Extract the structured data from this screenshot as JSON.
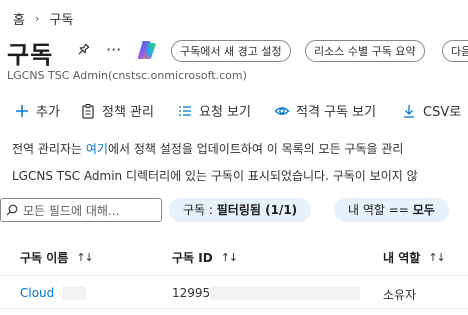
{
  "breadcrumb": {
    "home": "홈",
    "current": "구독"
  },
  "header": {
    "title": "구독",
    "subtitle": "LGCNS TSC Admin(cnstsc.onmicrosoft.com)",
    "chips": [
      "구독에서 새 경고 설정",
      "리소스 수별 구독 요약",
      "다음"
    ]
  },
  "toolbar": {
    "add": "추가",
    "policy": "정책 관리",
    "request": "요청 보기",
    "eligible": "적격 구독 보기",
    "csv": "CSV로"
  },
  "info": {
    "line1_pre": "전역 관리자는 ",
    "line1_link": "여기",
    "line1_post": "에서 정책 설정을 업데이트하여 이 목록의 모든 구독을 관리",
    "line2": "LGCNS TSC Admin 디렉터리에 있는 구독이 표시되었습니다. 구독이 보이지 않"
  },
  "filters": {
    "search_placeholder": "모든 필드에 대해...",
    "subscription_label": "구독 : ",
    "subscription_value": "필터링됨 (1/1)",
    "role_label": "내 역할 == ",
    "role_value": "모두"
  },
  "table": {
    "headers": [
      "구독 이름",
      "구독 ID",
      "내 역할"
    ],
    "sort_glyph": "↑↓",
    "rows": [
      {
        "name": "Cloud",
        "id": "12995",
        "role": "소유자"
      }
    ]
  },
  "colors": {
    "accent": "#0078d4",
    "filter_bg": "#e7f0fb"
  }
}
